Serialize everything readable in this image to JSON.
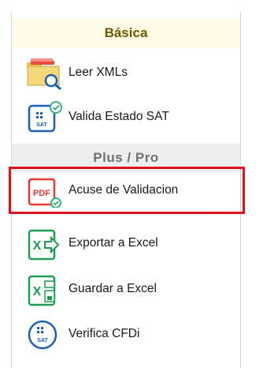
{
  "sections": {
    "basica": "Básica",
    "plus": "Plus / Pro"
  },
  "items": [
    {
      "label": "Leer XMLs",
      "icon": "folder-search-icon"
    },
    {
      "label": "Valida Estado SAT",
      "icon": "sat-check-icon"
    },
    {
      "label": "Acuse de Validacion",
      "icon": "pdf-check-icon"
    },
    {
      "label": "Exportar a Excel",
      "icon": "excel-export-icon"
    },
    {
      "label": "Guardar a Excel",
      "icon": "excel-save-icon"
    },
    {
      "label": "Verifica CFDi",
      "icon": "sat-circle-icon"
    }
  ],
  "icon_text": {
    "pdf": "PDF",
    "sat": "SAT",
    "excel_x": "X"
  },
  "colors": {
    "basica_bg": "#fffbe6",
    "basica_text": "#6b5b00",
    "plus_bg": "#eeeeee",
    "highlight": "#e0131b",
    "sat_blue": "#1b5fb4",
    "excel_green": "#1f9d55",
    "pdf_red": "#e53935",
    "check_green": "#36b37e"
  }
}
